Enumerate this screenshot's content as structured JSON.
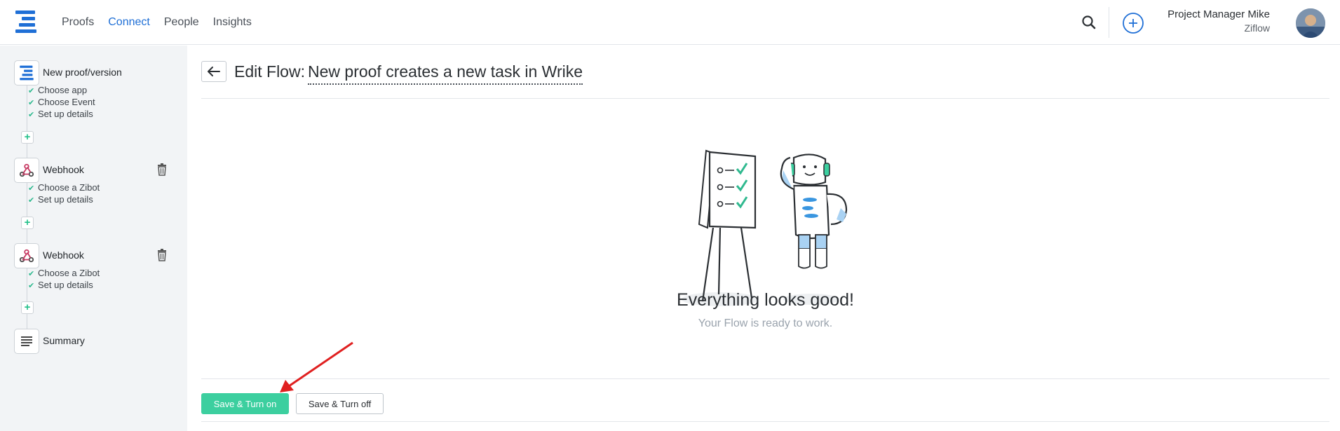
{
  "nav": {
    "items": [
      {
        "label": "Proofs",
        "active": false
      },
      {
        "label": "Connect",
        "active": true
      },
      {
        "label": "People",
        "active": false
      },
      {
        "label": "Insights",
        "active": false
      }
    ],
    "search_icon": "search-icon",
    "add_icon": "plus-circle-icon"
  },
  "user": {
    "name": "Project Manager Mike",
    "org": "Ziflow"
  },
  "sidebar": {
    "steps": [
      {
        "title": "New proof/version",
        "icon": "ziflow-logo-icon",
        "substeps": [
          "Choose app",
          "Choose Event",
          "Set up details"
        ]
      },
      {
        "title": "Webhook",
        "icon": "webhook-icon",
        "substeps": [
          "Choose a Zibot",
          "Set up details"
        ]
      },
      {
        "title": "Webhook",
        "icon": "webhook-icon",
        "substeps": [
          "Choose a Zibot",
          "Set up details"
        ]
      },
      {
        "title": "Summary",
        "icon": "summary-icon",
        "substeps": []
      }
    ]
  },
  "main": {
    "edit_label": "Edit Flow:",
    "flow_name": "New proof creates a new task in Wrike",
    "status_title": "Everything looks good!",
    "status_subtitle": "Your Flow is ready to work.",
    "save_on_label": "Save & Turn on",
    "save_off_label": "Save & Turn off"
  },
  "colors": {
    "accent": "#1f6fd6",
    "success": "#3ccf9f",
    "check": "#2fb98f",
    "annotation_arrow": "#e02020"
  }
}
